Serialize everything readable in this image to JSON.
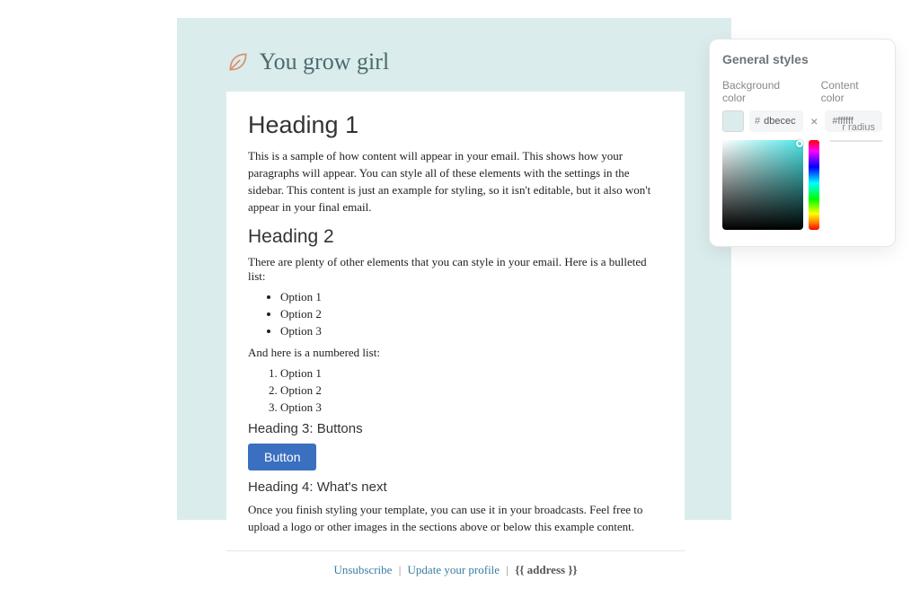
{
  "brand": {
    "name": "You grow girl"
  },
  "content": {
    "h1": "Heading 1",
    "p1": "This is a sample of how content will appear in your email. This shows how your paragraphs will appear. You can style all of these elements with the settings in the sidebar. This content is just an example for styling, so it isn't editable, but it also won't appear in your final email.",
    "h2": "Heading 2",
    "p2": "There are plenty of other elements that you can style in your email. Here is a bulleted list:",
    "bullets": [
      "Option 1",
      "Option 2",
      "Option 3"
    ],
    "p3": "And here is a numbered list:",
    "numbers": [
      "Option 1",
      "Option 2",
      "Option 3"
    ],
    "h3": "Heading 3: Buttons",
    "button": "Button",
    "h4": "Heading 4: What's next",
    "p4": "Once you finish styling your template, you can use it in your broadcasts. Feel free to upload a logo or other images in the sections above or below this example content."
  },
  "footer": {
    "unsubscribe": "Unsubscribe",
    "update": "Update your profile",
    "address": "{{ address }}"
  },
  "panel": {
    "title": "General styles",
    "bg_label": "Background color",
    "content_label": "Content color",
    "bg_hex": "dbecec",
    "content_hex": "#ffffff",
    "radius_label": "r radius",
    "bg_swatch": "#dbecec"
  }
}
